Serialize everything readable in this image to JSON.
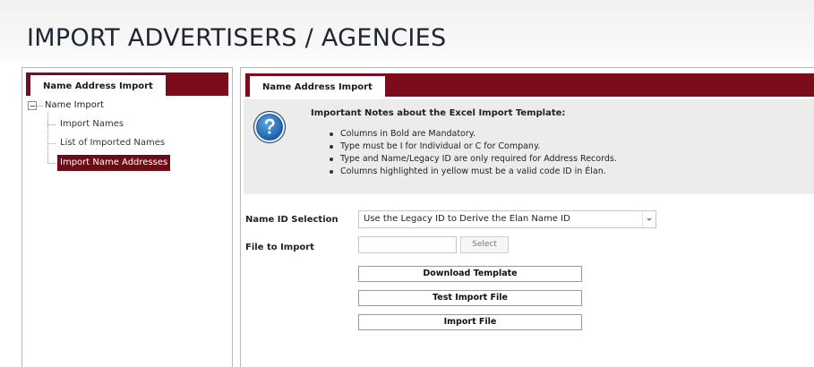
{
  "page": {
    "title": "IMPORT ADVERTISERS / AGENCIES"
  },
  "left_panel": {
    "tab_label": "Name Address Import",
    "tree": {
      "root_label": "Name Import",
      "items": [
        {
          "label": "Import Names",
          "selected": false
        },
        {
          "label": "List of Imported Names",
          "selected": false
        },
        {
          "label": "Import Name Addresses",
          "selected": true
        }
      ]
    }
  },
  "right_panel": {
    "tab_label": "Name Address Import",
    "notes": {
      "title": "Important Notes about the Excel Import Template:",
      "items": [
        "Columns in Bold are Mandatory.",
        "Type must be I for Individual or C for Company.",
        "Type and Name/Legacy ID are only required for Address Records.",
        "Columns highlighted in yellow must be a valid code ID in Élan."
      ]
    },
    "form": {
      "name_id_label": "Name ID Selection",
      "name_id_value": "Use the Legacy ID to Derive the Elan Name ID",
      "file_label": "File to Import",
      "file_value": "",
      "select_button": "Select"
    },
    "buttons": {
      "download_template": "Download Template",
      "test_import": "Test Import File",
      "import": "Import File"
    }
  },
  "colors": {
    "accent": "#7d0b1e",
    "selected_item_bg": "#6a0d16",
    "notes_bg": "#ececec"
  },
  "icons": {
    "help": "question-mark-circle-icon",
    "tree_toggle": "collapse-minus-icon",
    "dropdown": "chevron-down-icon"
  }
}
